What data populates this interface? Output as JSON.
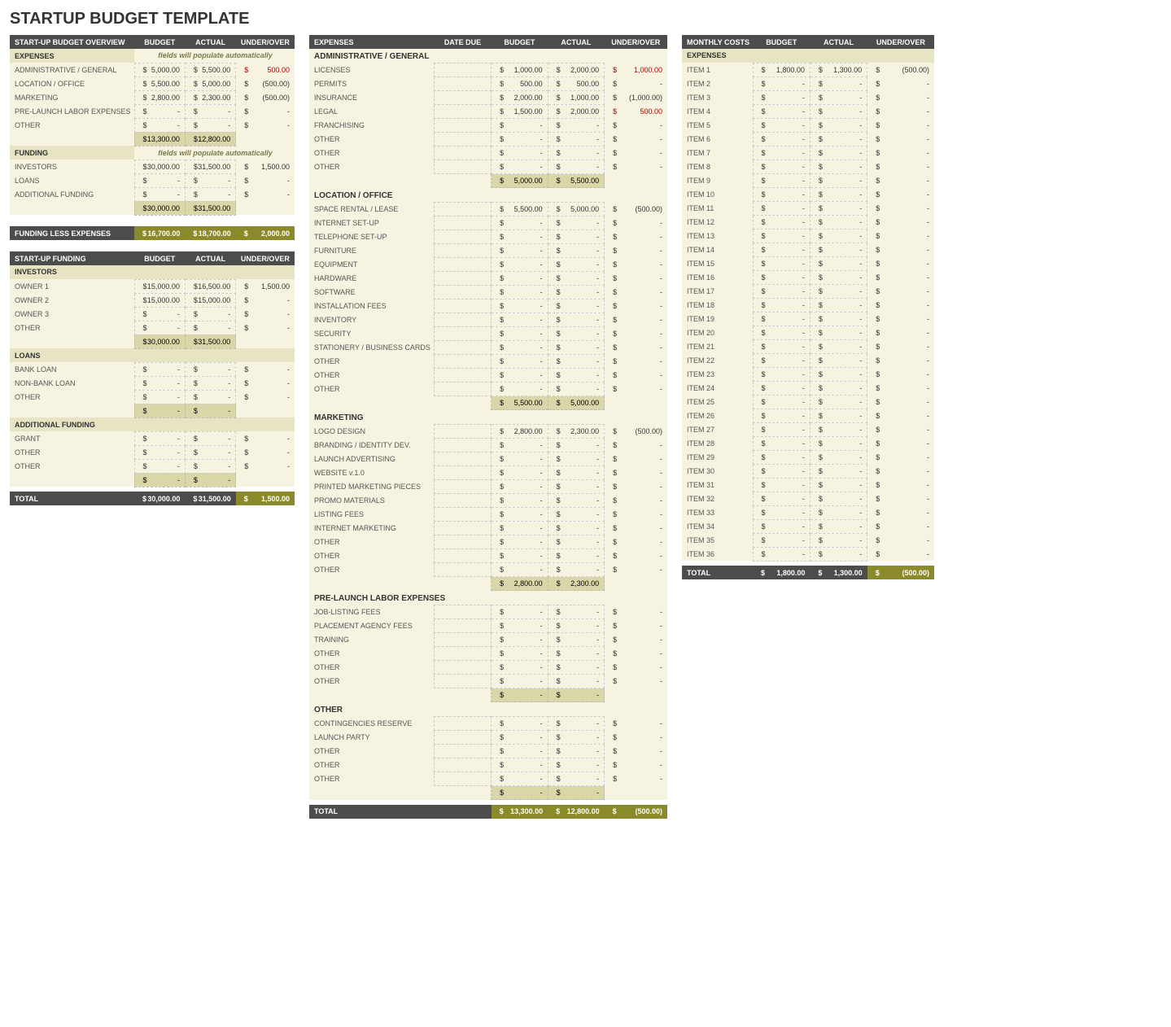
{
  "title": "STARTUP BUDGET TEMPLATE",
  "panel1": {
    "overview_hdr": [
      "START-UP BUDGET OVERVIEW",
      "BUDGET",
      "ACTUAL",
      "UNDER/OVER"
    ],
    "expenses_label": "EXPENSES",
    "auto_note": "fields will populate automatically",
    "exp_rows": [
      {
        "label": "ADMINISTRATIVE / GENERAL",
        "b": "5,000.00",
        "a": "5,500.00",
        "u": "500.00",
        "neg": true
      },
      {
        "label": "LOCATION / OFFICE",
        "b": "5,500.00",
        "a": "5,000.00",
        "u": "(500.00)",
        "neg": false
      },
      {
        "label": "MARKETING",
        "b": "2,800.00",
        "a": "2,300.00",
        "u": "(500.00)",
        "neg": false
      },
      {
        "label": "PRE-LAUNCH LABOR EXPENSES",
        "b": "-",
        "a": "-",
        "u": "-",
        "neg": false
      },
      {
        "label": "OTHER",
        "b": "-",
        "a": "-",
        "u": "-",
        "neg": false
      }
    ],
    "exp_sub": {
      "b": "13,300.00",
      "a": "12,800.00"
    },
    "funding_label": "FUNDING",
    "fund_rows": [
      {
        "label": "INVESTORS",
        "b": "30,000.00",
        "a": "31,500.00",
        "u": "1,500.00",
        "neg": false
      },
      {
        "label": "LOANS",
        "b": "-",
        "a": "-",
        "u": "-",
        "neg": false
      },
      {
        "label": "ADDITIONAL FUNDING",
        "b": "-",
        "a": "-",
        "u": "-",
        "neg": false
      }
    ],
    "fund_sub": {
      "b": "30,000.00",
      "a": "31,500.00"
    },
    "fle_row": {
      "label": "FUNDING LESS EXPENSES",
      "b": "16,700.00",
      "a": "18,700.00",
      "u": "2,000.00"
    },
    "funding_hdr": [
      "START-UP FUNDING",
      "BUDGET",
      "ACTUAL",
      "UNDER/OVER"
    ],
    "investors_label": "INVESTORS",
    "inv_rows": [
      {
        "label": "OWNER 1",
        "b": "15,000.00",
        "a": "16,500.00",
        "u": "1,500.00"
      },
      {
        "label": "OWNER 2",
        "b": "15,000.00",
        "a": "15,000.00",
        "u": "-"
      },
      {
        "label": "OWNER 3",
        "b": "-",
        "a": "-",
        "u": "-"
      },
      {
        "label": "OTHER",
        "b": "-",
        "a": "-",
        "u": "-"
      }
    ],
    "inv_sub": {
      "b": "30,000.00",
      "a": "31,500.00"
    },
    "loans_label": "LOANS",
    "loan_rows": [
      {
        "label": "BANK LOAN",
        "b": "-",
        "a": "-",
        "u": "-"
      },
      {
        "label": "NON-BANK LOAN",
        "b": "-",
        "a": "-",
        "u": "-"
      },
      {
        "label": "OTHER",
        "b": "-",
        "a": "-",
        "u": "-"
      }
    ],
    "loan_sub": {
      "b": "-",
      "a": "-"
    },
    "addl_label": "ADDITIONAL FUNDING",
    "addl_rows": [
      {
        "label": "GRANT",
        "b": "-",
        "a": "-",
        "u": "-"
      },
      {
        "label": "OTHER",
        "b": "-",
        "a": "-",
        "u": "-"
      },
      {
        "label": "OTHER",
        "b": "-",
        "a": "-",
        "u": "-"
      }
    ],
    "addl_sub": {
      "b": "-",
      "a": "-"
    },
    "total_row": {
      "label": "TOTAL",
      "b": "30,000.00",
      "a": "31,500.00",
      "u": "1,500.00"
    }
  },
  "panel2": {
    "hdr": [
      "EXPENSES",
      "DATE DUE",
      "BUDGET",
      "ACTUAL",
      "UNDER/OVER"
    ],
    "cats": [
      {
        "name": "ADMINISTRATIVE / GENERAL",
        "rows": [
          {
            "label": "LICENSES",
            "b": "1,000.00",
            "a": "2,000.00",
            "u": "1,000.00",
            "neg": true
          },
          {
            "label": "PERMITS",
            "b": "500.00",
            "a": "500.00",
            "u": "-"
          },
          {
            "label": "INSURANCE",
            "b": "2,000.00",
            "a": "1,000.00",
            "u": "(1,000.00)"
          },
          {
            "label": "LEGAL",
            "b": "1,500.00",
            "a": "2,000.00",
            "u": "500.00",
            "neg": true
          },
          {
            "label": "FRANCHISING",
            "b": "-",
            "a": "-",
            "u": "-"
          },
          {
            "label": "OTHER",
            "b": "-",
            "a": "-",
            "u": "-"
          },
          {
            "label": "OTHER",
            "b": "-",
            "a": "-",
            "u": "-"
          },
          {
            "label": "OTHER",
            "b": "-",
            "a": "-",
            "u": "-"
          }
        ],
        "sub": {
          "b": "5,000.00",
          "a": "5,500.00"
        }
      },
      {
        "name": "LOCATION / OFFICE",
        "rows": [
          {
            "label": "SPACE RENTAL / LEASE",
            "b": "5,500.00",
            "a": "5,000.00",
            "u": "(500.00)"
          },
          {
            "label": "INTERNET SET-UP",
            "b": "-",
            "a": "-",
            "u": "-"
          },
          {
            "label": "TELEPHONE SET-UP",
            "b": "-",
            "a": "-",
            "u": "-"
          },
          {
            "label": "FURNITURE",
            "b": "-",
            "a": "-",
            "u": "-"
          },
          {
            "label": "EQUIPMENT",
            "b": "-",
            "a": "-",
            "u": "-"
          },
          {
            "label": "HARDWARE",
            "b": "-",
            "a": "-",
            "u": "-"
          },
          {
            "label": "SOFTWARE",
            "b": "-",
            "a": "-",
            "u": "-"
          },
          {
            "label": "INSTALLATION FEES",
            "b": "-",
            "a": "-",
            "u": "-"
          },
          {
            "label": "INVENTORY",
            "b": "-",
            "a": "-",
            "u": "-"
          },
          {
            "label": "SECURITY",
            "b": "-",
            "a": "-",
            "u": "-"
          },
          {
            "label": "STATIONERY / BUSINESS CARDS",
            "b": "-",
            "a": "-",
            "u": "-"
          },
          {
            "label": "OTHER",
            "b": "-",
            "a": "-",
            "u": "-"
          },
          {
            "label": "OTHER",
            "b": "-",
            "a": "-",
            "u": "-"
          },
          {
            "label": "OTHER",
            "b": "-",
            "a": "-",
            "u": "-"
          }
        ],
        "sub": {
          "b": "5,500.00",
          "a": "5,000.00"
        }
      },
      {
        "name": "MARKETING",
        "rows": [
          {
            "label": "LOGO DESIGN",
            "b": "2,800.00",
            "a": "2,300.00",
            "u": "(500.00)"
          },
          {
            "label": "BRANDING / IDENTITY DEV.",
            "b": "-",
            "a": "-",
            "u": "-"
          },
          {
            "label": "LAUNCH ADVERTISING",
            "b": "-",
            "a": "-",
            "u": "-"
          },
          {
            "label": "WEBSITE v.1.0",
            "b": "-",
            "a": "-",
            "u": "-"
          },
          {
            "label": "PRINTED MARKETING PIECES",
            "b": "-",
            "a": "-",
            "u": "-"
          },
          {
            "label": "PROMO MATERIALS",
            "b": "-",
            "a": "-",
            "u": "-"
          },
          {
            "label": "LISTING FEES",
            "b": "-",
            "a": "-",
            "u": "-"
          },
          {
            "label": "INTERNET MARKETING",
            "b": "-",
            "a": "-",
            "u": "-"
          },
          {
            "label": "OTHER",
            "b": "-",
            "a": "-",
            "u": "-"
          },
          {
            "label": "OTHER",
            "b": "-",
            "a": "-",
            "u": "-"
          },
          {
            "label": "OTHER",
            "b": "-",
            "a": "-",
            "u": "-"
          }
        ],
        "sub": {
          "b": "2,800.00",
          "a": "2,300.00"
        }
      },
      {
        "name": "PRE-LAUNCH LABOR EXPENSES",
        "rows": [
          {
            "label": "JOB-LISTING FEES",
            "b": "-",
            "a": "-",
            "u": "-"
          },
          {
            "label": "PLACEMENT AGENCY FEES",
            "b": "-",
            "a": "-",
            "u": "-"
          },
          {
            "label": "TRAINING",
            "b": "-",
            "a": "-",
            "u": "-"
          },
          {
            "label": "OTHER",
            "b": "-",
            "a": "-",
            "u": "-"
          },
          {
            "label": "OTHER",
            "b": "-",
            "a": "-",
            "u": "-"
          },
          {
            "label": "OTHER",
            "b": "-",
            "a": "-",
            "u": "-"
          }
        ],
        "sub": {
          "b": "-",
          "a": "-"
        }
      },
      {
        "name": "OTHER",
        "rows": [
          {
            "label": "CONTINGENCIES RESERVE",
            "b": "-",
            "a": "-",
            "u": "-"
          },
          {
            "label": "LAUNCH PARTY",
            "b": "-",
            "a": "-",
            "u": "-"
          },
          {
            "label": "OTHER",
            "b": "-",
            "a": "-",
            "u": "-"
          },
          {
            "label": "OTHER",
            "b": "-",
            "a": "-",
            "u": "-"
          },
          {
            "label": "OTHER",
            "b": "-",
            "a": "-",
            "u": "-"
          }
        ],
        "sub": {
          "b": "-",
          "a": "-"
        }
      }
    ],
    "total": {
      "label": "TOTAL",
      "b": "13,300.00",
      "a": "12,800.00",
      "u": "(500.00)"
    }
  },
  "panel3": {
    "hdr": [
      "MONTHLY COSTS",
      "BUDGET",
      "ACTUAL",
      "UNDER/OVER"
    ],
    "expenses_label": "EXPENSES",
    "rows": [
      {
        "label": "ITEM 1",
        "b": "1,800.00",
        "a": "1,300.00",
        "u": "(500.00)"
      },
      {
        "label": "ITEM 2",
        "b": "-",
        "a": "-",
        "u": "-"
      },
      {
        "label": "ITEM 3",
        "b": "-",
        "a": "-",
        "u": "-"
      },
      {
        "label": "ITEM 4",
        "b": "-",
        "a": "-",
        "u": "-"
      },
      {
        "label": "ITEM 5",
        "b": "-",
        "a": "-",
        "u": "-"
      },
      {
        "label": "ITEM 6",
        "b": "-",
        "a": "-",
        "u": "-"
      },
      {
        "label": "ITEM 7",
        "b": "-",
        "a": "-",
        "u": "-"
      },
      {
        "label": "ITEM 8",
        "b": "-",
        "a": "-",
        "u": "-"
      },
      {
        "label": "ITEM 9",
        "b": "-",
        "a": "-",
        "u": "-"
      },
      {
        "label": "ITEM 10",
        "b": "-",
        "a": "-",
        "u": "-"
      },
      {
        "label": "ITEM 11",
        "b": "-",
        "a": "-",
        "u": "-"
      },
      {
        "label": "ITEM 12",
        "b": "-",
        "a": "-",
        "u": "-"
      },
      {
        "label": "ITEM 13",
        "b": "-",
        "a": "-",
        "u": "-"
      },
      {
        "label": "ITEM 14",
        "b": "-",
        "a": "-",
        "u": "-"
      },
      {
        "label": "ITEM 15",
        "b": "-",
        "a": "-",
        "u": "-"
      },
      {
        "label": "ITEM 16",
        "b": "-",
        "a": "-",
        "u": "-"
      },
      {
        "label": "ITEM 17",
        "b": "-",
        "a": "-",
        "u": "-"
      },
      {
        "label": "ITEM 18",
        "b": "-",
        "a": "-",
        "u": "-"
      },
      {
        "label": "ITEM 19",
        "b": "-",
        "a": "-",
        "u": "-"
      },
      {
        "label": "ITEM 20",
        "b": "-",
        "a": "-",
        "u": "-"
      },
      {
        "label": "ITEM 21",
        "b": "-",
        "a": "-",
        "u": "-"
      },
      {
        "label": "ITEM 22",
        "b": "-",
        "a": "-",
        "u": "-"
      },
      {
        "label": "ITEM 23",
        "b": "-",
        "a": "-",
        "u": "-"
      },
      {
        "label": "ITEM 24",
        "b": "-",
        "a": "-",
        "u": "-"
      },
      {
        "label": "ITEM 25",
        "b": "-",
        "a": "-",
        "u": "-"
      },
      {
        "label": "ITEM 26",
        "b": "-",
        "a": "-",
        "u": "-"
      },
      {
        "label": "ITEM 27",
        "b": "-",
        "a": "-",
        "u": "-"
      },
      {
        "label": "ITEM 28",
        "b": "-",
        "a": "-",
        "u": "-"
      },
      {
        "label": "ITEM 29",
        "b": "-",
        "a": "-",
        "u": "-"
      },
      {
        "label": "ITEM 30",
        "b": "-",
        "a": "-",
        "u": "-"
      },
      {
        "label": "ITEM 31",
        "b": "-",
        "a": "-",
        "u": "-"
      },
      {
        "label": "ITEM 32",
        "b": "-",
        "a": "-",
        "u": "-"
      },
      {
        "label": "ITEM 33",
        "b": "-",
        "a": "-",
        "u": "-"
      },
      {
        "label": "ITEM 34",
        "b": "-",
        "a": "-",
        "u": "-"
      },
      {
        "label": "ITEM 35",
        "b": "-",
        "a": "-",
        "u": "-"
      },
      {
        "label": "ITEM 36",
        "b": "-",
        "a": "-",
        "u": "-"
      }
    ],
    "total": {
      "label": "TOTAL",
      "b": "1,800.00",
      "a": "1,300.00",
      "u": "(500.00)"
    }
  }
}
